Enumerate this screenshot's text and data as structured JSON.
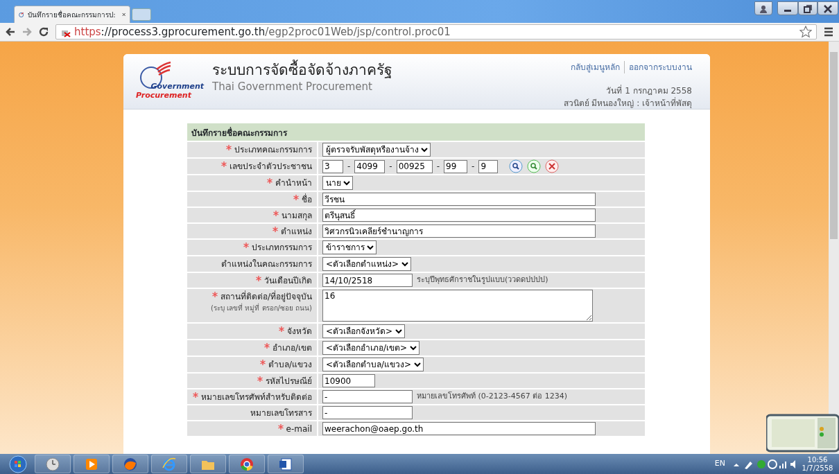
{
  "browser": {
    "tab_title": "บันทึกรายชื่อคณะกรรมการป:",
    "address": {
      "scheme": "https",
      "host": "://process3.gprocurement.go.th",
      "path": "/egp2proc01Web/jsp/control.proc01"
    }
  },
  "header": {
    "logo_top": "Government",
    "logo_bottom": "Procurement",
    "title": "ระบบการจัดซื้อจัดจ้างภาครัฐ",
    "subtitle": "Thai Government Procurement",
    "links": [
      "กลับสู่เมนูหลัก",
      "ออกจากระบบงาน"
    ],
    "date": "วันที่ 1 กรกฎาคม 2558",
    "user": "สวนิตย์ มีหนองใหญ่ : เจ้าหน้าที่พัสดุ"
  },
  "form": {
    "title": "บันทึกรายชื่อคณะกรรมการ",
    "rows": [
      {
        "label": "ประเภทคณะกรรมการ",
        "required": true,
        "kind": "select",
        "value": "ผู้ตรวจรับพัสดุหรืองานจ้าง"
      },
      {
        "label": "เลขประจำตัวประชาชน",
        "required": true,
        "kind": "id",
        "parts": [
          "3",
          "4099",
          "00925",
          "99",
          "9"
        ],
        "separator": "-"
      },
      {
        "label": "คำนำหน้า",
        "required": true,
        "kind": "select",
        "value": "นาย"
      },
      {
        "label": "ชื่อ",
        "required": true,
        "kind": "text",
        "value": "วีรชน"
      },
      {
        "label": "นามสกุล",
        "required": true,
        "kind": "text",
        "value": "ตรีนุสนธิ์"
      },
      {
        "label": "ตำแหน่ง",
        "required": true,
        "kind": "text",
        "value": "วิศวกรนิวเคลียร์ชำนาญการ"
      },
      {
        "label": "ประเภทกรรมการ",
        "required": true,
        "kind": "select",
        "value": "ข้าราชการ"
      },
      {
        "label": "ตำแหน่งในคณะกรรมการ",
        "required": false,
        "kind": "select",
        "value": "<ตัวเลือกตำแหน่ง>"
      },
      {
        "label": "วันเดือนปีเกิด",
        "required": true,
        "kind": "short",
        "value": "14/10/2518",
        "hint": "ระบุปีพุทธศักราชในรูปแบบ(ววดดปปปป)"
      },
      {
        "label": "สถานที่ติดต่อ/ที่อยู่ปัจจุบัน",
        "sublabel": "(ระบุ เลขที่ หมู่ที่ ตรอก/ซอย ถนน)",
        "required": true,
        "kind": "textarea",
        "value": "16"
      },
      {
        "label": "จังหวัด",
        "required": true,
        "kind": "select",
        "value": "<ตัวเลือกจังหวัด>"
      },
      {
        "label": "อำเภอ/เขต",
        "required": true,
        "kind": "select",
        "value": "<ตัวเลือกอำเภอ/เขต>"
      },
      {
        "label": "ตำบล/แขวง",
        "required": true,
        "kind": "select",
        "value": "<ตัวเลือกตำบล/แขวง>"
      },
      {
        "label": "รหัสไปรษณีย์",
        "required": true,
        "kind": "tiny",
        "value": "10900"
      },
      {
        "label": "หมายเลขโทรศัพท์สำหรับติดต่อ",
        "required": true,
        "kind": "short",
        "value": "-",
        "hint": "หมายเลขโทรศัพท์ (0-2123-4567 ต่อ 1234)"
      },
      {
        "label": "หมายเลขโทรสาร",
        "required": false,
        "kind": "short",
        "value": "-"
      },
      {
        "label": "e-mail",
        "required": true,
        "kind": "text",
        "value": "weerachon@oaep.go.th"
      }
    ]
  },
  "taskbar": {
    "language": "EN",
    "time": "10:56",
    "date": "1/7/2558"
  }
}
